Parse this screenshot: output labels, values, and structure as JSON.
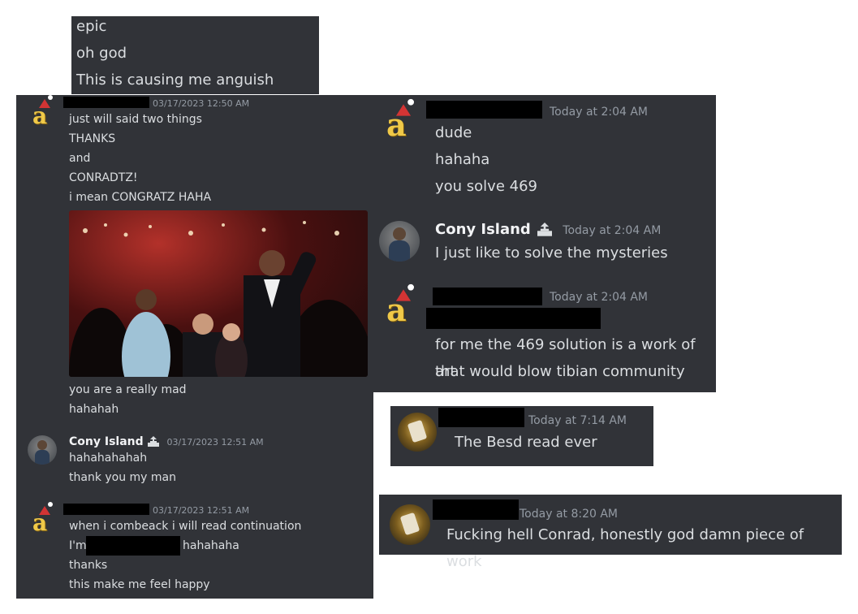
{
  "panel_top": {
    "lines": [
      "epic",
      "oh god",
      "This is causing me anguish hahaha"
    ]
  },
  "panel_left": {
    "msg1": {
      "avatar": "amazon-a-santa-hat-icon",
      "timestamp": "03/17/2023 12:50 AM",
      "lines": [
        "just will said two things",
        "THANKS",
        "and",
        "CONRADTZ!",
        "i mean CONGRATZ HAHA"
      ],
      "after_gif": [
        "you are a really mad",
        "hahahah"
      ]
    },
    "msg2": {
      "name": "Cony Island",
      "timestamp": "03/17/2023 12:51 AM",
      "lines": [
        "hahahahahah",
        "thank you my man"
      ]
    },
    "msg3": {
      "timestamp": "03/17/2023 12:51 AM",
      "line1": "when i combeack i will read continuation",
      "line2_prefix": "I'm",
      "line2_suffix": "hahahaha",
      "line3": "thanks",
      "line4": "this make me feel happy"
    }
  },
  "panel_right": {
    "msg1": {
      "timestamp": "Today at 2:04 AM",
      "lines": [
        "dude",
        "hahaha",
        "you solve 469"
      ]
    },
    "msg2": {
      "name": "Cony Island",
      "timestamp": "Today at 2:04 AM",
      "line": "I just like to solve the mysteries"
    },
    "msg3": {
      "timestamp": "Today at 2:04 AM",
      "lines": [
        "for me the 469 solution is a work of art",
        "that would blow tibian community"
      ]
    }
  },
  "panel_mid": {
    "timestamp": "Today at 7:14 AM",
    "line": "The Besd read ever"
  },
  "panel_bottom": {
    "timestamp": "Today at 8:20 AM",
    "line": "Fucking hell Conrad, honestly god damn piece of work"
  },
  "colors": {
    "panel_bg": "#313338",
    "text": "#dbdee1",
    "timestamp": "#949ba4",
    "avatar_gold": "#f0c948"
  }
}
